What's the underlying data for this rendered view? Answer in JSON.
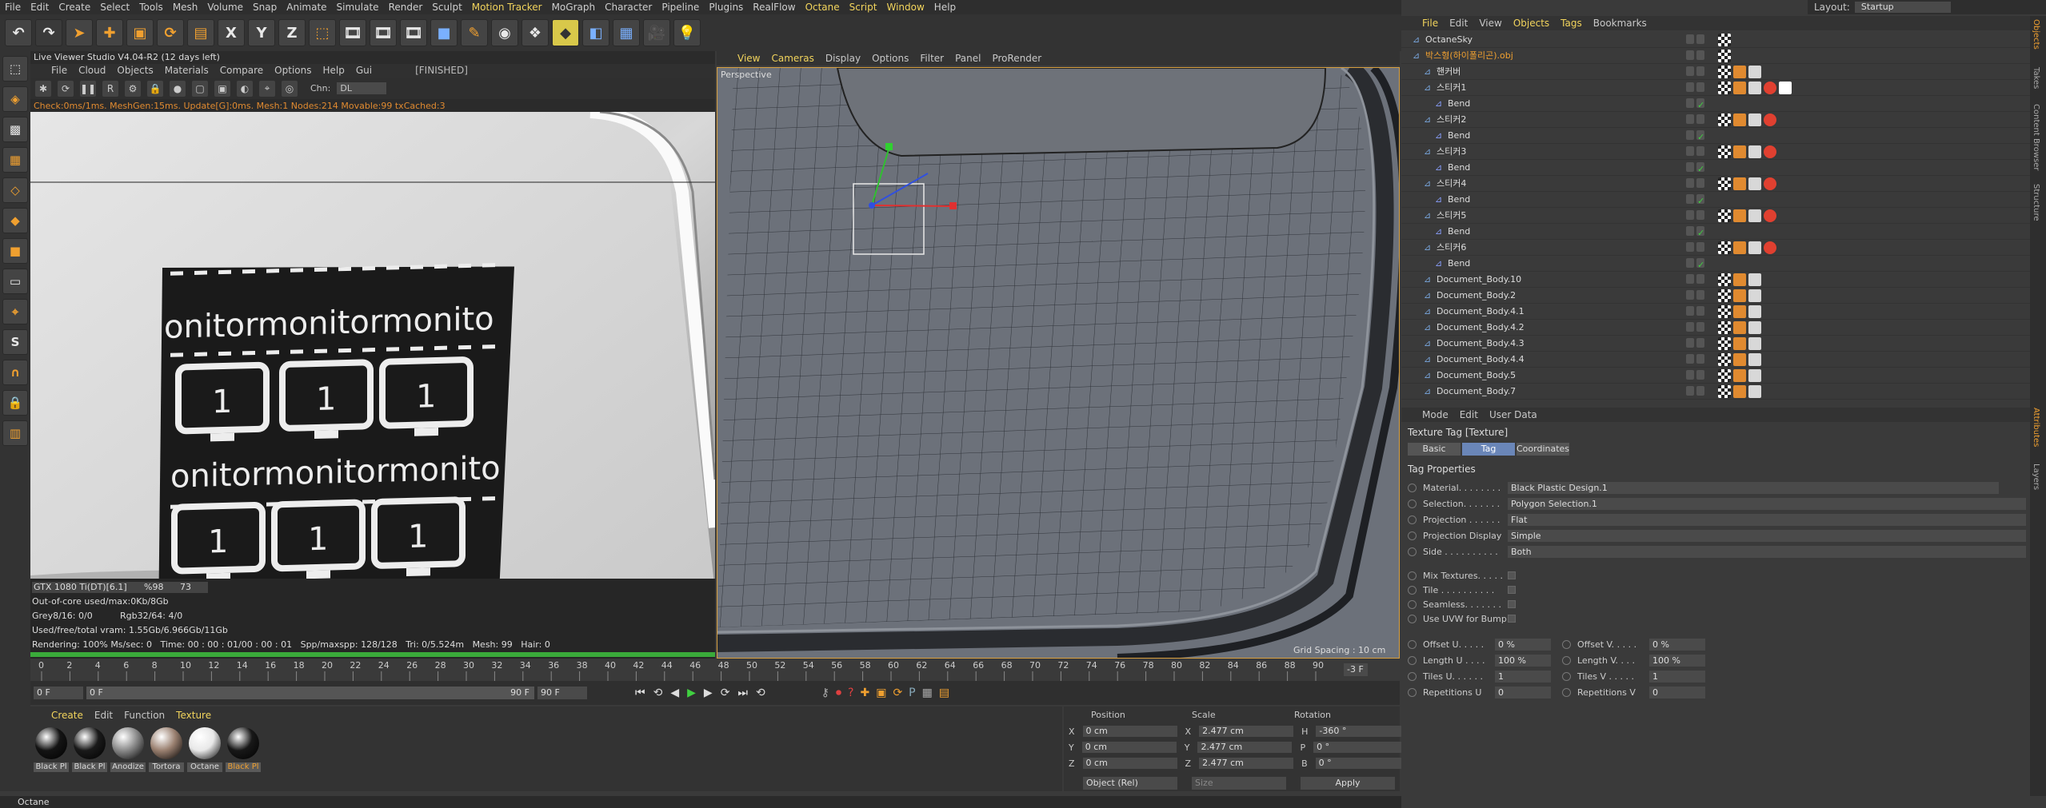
{
  "menubar": {
    "items": [
      "File",
      "Edit",
      "Create",
      "Select",
      "Tools",
      "Mesh",
      "Volume",
      "Snap",
      "Animate",
      "Simulate",
      "Render",
      "Sculpt",
      "Motion Tracker",
      "MoGraph",
      "Character",
      "Pipeline",
      "Plugins",
      "RealFlow",
      "Octane",
      "Script",
      "Window",
      "Help"
    ],
    "highlighted": [
      "Motion Tracker",
      "Octane",
      "Script",
      "Window"
    ],
    "layout_label": "Layout:",
    "layout_value": "Startup"
  },
  "toolbar": {
    "axes": [
      "X",
      "Y",
      "Z"
    ]
  },
  "live_viewer": {
    "title": "Live Viewer Studio V4.04-R2 (12 days left)",
    "menu": [
      "File",
      "Cloud",
      "Objects",
      "Materials",
      "Compare",
      "Options",
      "Help",
      "Gui"
    ],
    "status": "[FINISHED]",
    "chn_label": "Chn:",
    "chn_value": "DL",
    "stats": "Check:0ms/1ms. MeshGen:15ms. Update[G]:0ms. Mesh:1 Nodes:214 Movable:99 txCached:3",
    "gpu": {
      "name": "GTX 1080 Ti(DT)[6.1]",
      "pct": "%98",
      "temp": "73"
    },
    "ooc": "Out-of-core used/max:0Kb/8Gb",
    "grey": "Grey8/16: 0/0",
    "rgb": "Rgb32/64: 4/0",
    "vram": "Used/free/total vram: 1.55Gb/6.966Gb/11Gb",
    "render_line": "Rendering: 100% Ms/sec: 0   Time: 00 : 00 : 01/00 : 00 : 01   Spp/maxspp: 128/128   Tri: 0/5.524m   Mesh: 99   Hair: 0",
    "texture_word": "onitormonitormonito",
    "texture_number": "1"
  },
  "viewport": {
    "menu": [
      "View",
      "Cameras",
      "Display",
      "Options",
      "Filter",
      "Panel",
      "ProRender"
    ],
    "highlighted": [
      "View",
      "Cameras"
    ],
    "label": "Perspective",
    "grid_spacing": "Grid Spacing : 10 cm"
  },
  "timeline": {
    "ticks": [
      "0",
      "2",
      "4",
      "6",
      "8",
      "10",
      "12",
      "14",
      "16",
      "18",
      "20",
      "22",
      "24",
      "26",
      "28",
      "30",
      "32",
      "34",
      "36",
      "38",
      "40",
      "42",
      "44",
      "46",
      "48",
      "50",
      "52",
      "54",
      "56",
      "58",
      "60",
      "62",
      "64",
      "66",
      "68",
      "70",
      "72",
      "74",
      "76",
      "78",
      "80",
      "82",
      "84",
      "86",
      "88",
      "90"
    ],
    "current_frame": "-3 F",
    "start": "0 F",
    "range_start": "0 F",
    "range_end": "90 F",
    "end": "90 F"
  },
  "material_manager": {
    "menu": [
      "Create",
      "Edit",
      "Function",
      "Texture"
    ],
    "highlighted": [
      "Create",
      "Texture"
    ],
    "materials": [
      {
        "label": "Black Pl",
        "color": "#141414"
      },
      {
        "label": "Black Pl",
        "color": "#1a1a1a"
      },
      {
        "label": "Anodize",
        "color": "#8a8a8a"
      },
      {
        "label": "Tortora",
        "color": "#9a8070"
      },
      {
        "label": "Octane",
        "color": "#e8e8e8"
      },
      {
        "label": "Black Pl",
        "color": "#181818"
      }
    ],
    "selected_index": 5
  },
  "coordinates": {
    "headers": [
      "Position",
      "Scale",
      "Rotation"
    ],
    "rows": [
      {
        "pl": "X",
        "pv": "0 cm",
        "sl": "X",
        "sv": "2.477 cm",
        "rl": "H",
        "rv": "-360 °"
      },
      {
        "pl": "Y",
        "pv": "0 cm",
        "sl": "Y",
        "sv": "2.477 cm",
        "rl": "P",
        "rv": "0 °"
      },
      {
        "pl": "Z",
        "pv": "0 cm",
        "sl": "Z",
        "sv": "2.477 cm",
        "rl": "B",
        "rv": "0 °"
      }
    ],
    "mode": "Object (Rel)",
    "size": "Size",
    "apply": "Apply"
  },
  "status_bar": "Octane",
  "object_manager": {
    "menu": [
      "File",
      "Edit",
      "View",
      "Objects",
      "Tags",
      "Bookmarks"
    ],
    "highlighted": [
      "File",
      "Objects",
      "Tags"
    ],
    "rows": [
      {
        "name": "OctaneSky",
        "indent": 0,
        "tags": 1
      },
      {
        "name": "박스형(하이폴리곤).obj",
        "indent": 0,
        "tags": 1,
        "orange": true
      },
      {
        "name": "핸커버",
        "indent": 1,
        "tags": 3
      },
      {
        "name": "스티커1",
        "indent": 1,
        "tags": 5
      },
      {
        "name": "Bend",
        "indent": 2,
        "tags": 0
      },
      {
        "name": "스티커2",
        "indent": 1,
        "tags": 4
      },
      {
        "name": "Bend",
        "indent": 2,
        "tags": 0
      },
      {
        "name": "스티커3",
        "indent": 1,
        "tags": 4
      },
      {
        "name": "Bend",
        "indent": 2,
        "tags": 0
      },
      {
        "name": "스티커4",
        "indent": 1,
        "tags": 4
      },
      {
        "name": "Bend",
        "indent": 2,
        "tags": 0
      },
      {
        "name": "스티커5",
        "indent": 1,
        "tags": 4
      },
      {
        "name": "Bend",
        "indent": 2,
        "tags": 0
      },
      {
        "name": "스티커6",
        "indent": 1,
        "tags": 4
      },
      {
        "name": "Bend",
        "indent": 2,
        "tags": 0
      },
      {
        "name": "Document_Body.10",
        "indent": 1,
        "tags": 3
      },
      {
        "name": "Document_Body.2",
        "indent": 1,
        "tags": 3
      },
      {
        "name": "Document_Body.4.1",
        "indent": 1,
        "tags": 3
      },
      {
        "name": "Document_Body.4.2",
        "indent": 1,
        "tags": 3
      },
      {
        "name": "Document_Body.4.3",
        "indent": 1,
        "tags": 3
      },
      {
        "name": "Document_Body.4.4",
        "indent": 1,
        "tags": 3
      },
      {
        "name": "Document_Body.5",
        "indent": 1,
        "tags": 3
      },
      {
        "name": "Document_Body.7",
        "indent": 1,
        "tags": 3
      }
    ]
  },
  "attribute_manager": {
    "menu": [
      "Mode",
      "Edit",
      "User Data"
    ],
    "title": "Texture Tag [Texture]",
    "tabs": [
      "Basic",
      "Tag",
      "Coordinates"
    ],
    "active_tab": "Tag",
    "section": "Tag Properties",
    "props": [
      {
        "label": "Material. . . . . . . .",
        "value": "Black Plastic Design.1"
      },
      {
        "label": "Selection. . . . . . .",
        "value": "Polygon Selection.1"
      },
      {
        "label": "Projection . . . . . .",
        "value": "Flat"
      },
      {
        "label": "Projection Display",
        "value": "Simple"
      },
      {
        "label": "Side . . . . . . . . . .",
        "value": "Both"
      }
    ],
    "checks": [
      {
        "label": "Mix Textures. . . . ."
      },
      {
        "label": "Tile . . . . . . . . . ."
      },
      {
        "label": "Seamless. . . . . . ."
      },
      {
        "label": "Use UVW for Bump"
      }
    ],
    "offsets": [
      {
        "l1": "Offset U. . . . .",
        "v1": "0 %",
        "l2": "Offset V. . . . .",
        "v2": "0 %"
      },
      {
        "l1": "Length U . . . .",
        "v1": "100 %",
        "l2": "Length V. . . .",
        "v2": "100 %"
      },
      {
        "l1": "Tiles U. . . . . .",
        "v1": "1",
        "l2": "Tiles V . . . . .",
        "v2": "1"
      },
      {
        "l1": "Repetitions U",
        "v1": "0",
        "l2": "Repetitions V",
        "v2": "0"
      }
    ]
  },
  "right_tabs": [
    "Objects",
    "Takes",
    "Content Browser",
    "Structure",
    "Attributes",
    "Layers"
  ]
}
